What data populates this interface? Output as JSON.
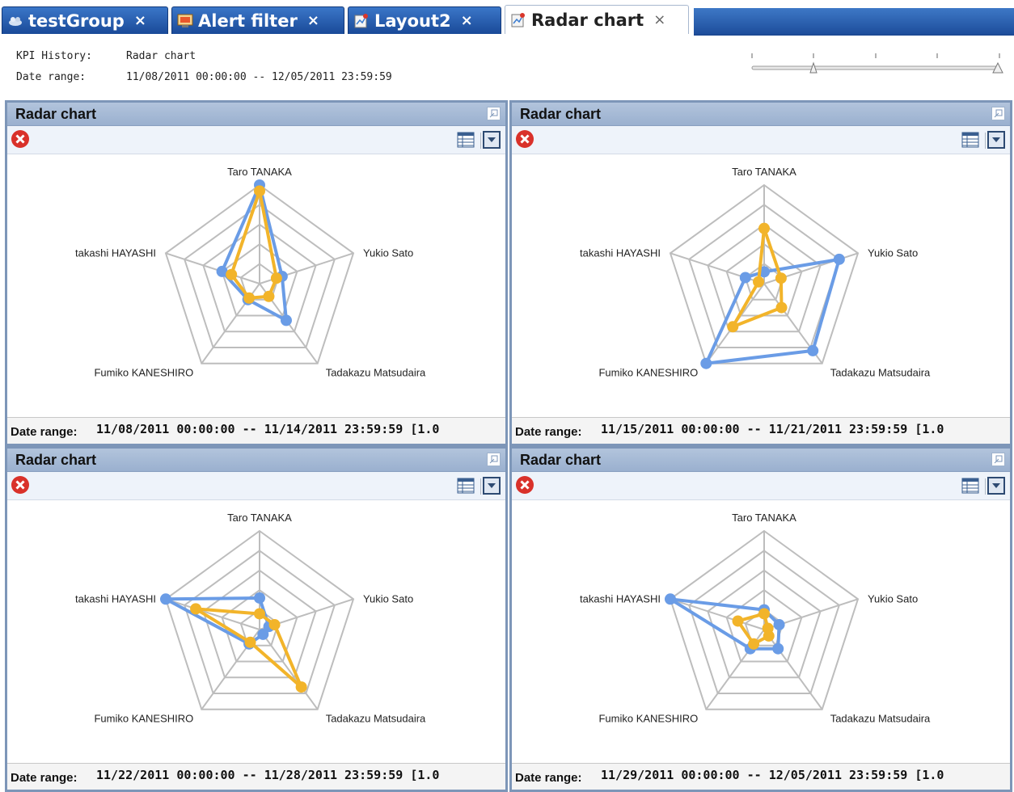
{
  "tabs": [
    {
      "label": "testGroup",
      "icon": "group-icon",
      "close": "×"
    },
    {
      "label": "Alert filter",
      "icon": "alert-filter-icon",
      "close": "×"
    },
    {
      "label": "Layout2",
      "icon": "layout-icon",
      "close": "×"
    },
    {
      "label": "Radar chart",
      "icon": "radar-chart-icon",
      "close": "×",
      "active": true
    }
  ],
  "header": {
    "kpi_label": "KPI History:",
    "kpi_value": "Radar chart",
    "date_label": "Date range:",
    "date_value": "11/08/2011 00:00:00 -- 12/05/2011 23:59:59"
  },
  "slider": {
    "ticks": 5,
    "handles": [
      0.25,
      1.0
    ]
  },
  "colors": {
    "series_blue": "#6a9ce6",
    "series_orange": "#f2b42a",
    "grid": "#bdbdbd"
  },
  "panels": [
    {
      "title": "Radar chart",
      "footer_label": "Date range:",
      "footer_value": "11/08/2011 00:00:00 -- 11/14/2011 23:59:59 [1.0"
    },
    {
      "title": "Radar chart",
      "footer_label": "Date range:",
      "footer_value": "11/15/2011 00:00:00 -- 11/21/2011 23:59:59 [1.0"
    },
    {
      "title": "Radar chart",
      "footer_label": "Date range:",
      "footer_value": "11/22/2011 00:00:00 -- 11/28/2011 23:59:59 [1.0"
    },
    {
      "title": "Radar chart",
      "footer_label": "Date range:",
      "footer_value": "11/29/2011 00:00:00 -- 12/05/2011 23:59:59 [1.0"
    }
  ],
  "chart_data": [
    {
      "type": "radar",
      "axes": [
        "Taro TANAKA",
        "Yukio Sato",
        "Tadakazu Matsudaira",
        "Fumiko KANESHIRO",
        "takashi HAYASHI"
      ],
      "rmax": 5,
      "series": [
        {
          "color": "#6a9ce6",
          "values": [
            5.0,
            1.2,
            2.3,
            1.0,
            2.0
          ]
        },
        {
          "color": "#f2b42a",
          "values": [
            4.7,
            0.9,
            0.8,
            0.9,
            1.5
          ]
        }
      ]
    },
    {
      "type": "radar",
      "axes": [
        "Taro TANAKA",
        "Yukio Sato",
        "Tadakazu Matsudaira",
        "Fumiko KANESHIRO",
        "takashi HAYASHI"
      ],
      "rmax": 5,
      "series": [
        {
          "color": "#6a9ce6",
          "values": [
            0.6,
            4.0,
            4.2,
            5.0,
            1.0
          ]
        },
        {
          "color": "#f2b42a",
          "values": [
            2.8,
            0.9,
            1.5,
            2.7,
            0.3
          ]
        }
      ]
    },
    {
      "type": "radar",
      "axes": [
        "Taro TANAKA",
        "Yukio Sato",
        "Tadakazu Matsudaira",
        "Fumiko KANESHIRO",
        "takashi HAYASHI"
      ],
      "rmax": 5,
      "series": [
        {
          "color": "#6a9ce6",
          "values": [
            1.6,
            0.5,
            0.3,
            0.9,
            5.0
          ]
        },
        {
          "color": "#f2b42a",
          "values": [
            0.8,
            0.8,
            3.6,
            0.8,
            3.4
          ]
        }
      ]
    },
    {
      "type": "radar",
      "axes": [
        "Taro TANAKA",
        "Yukio Sato",
        "Tadakazu Matsudaira",
        "Fumiko KANESHIRO",
        "takashi HAYASHI"
      ],
      "rmax": 5,
      "series": [
        {
          "color": "#6a9ce6",
          "values": [
            1.0,
            0.8,
            1.2,
            1.2,
            5.0
          ]
        },
        {
          "color": "#f2b42a",
          "values": [
            0.8,
            0.2,
            0.4,
            0.9,
            1.4
          ]
        }
      ]
    }
  ]
}
